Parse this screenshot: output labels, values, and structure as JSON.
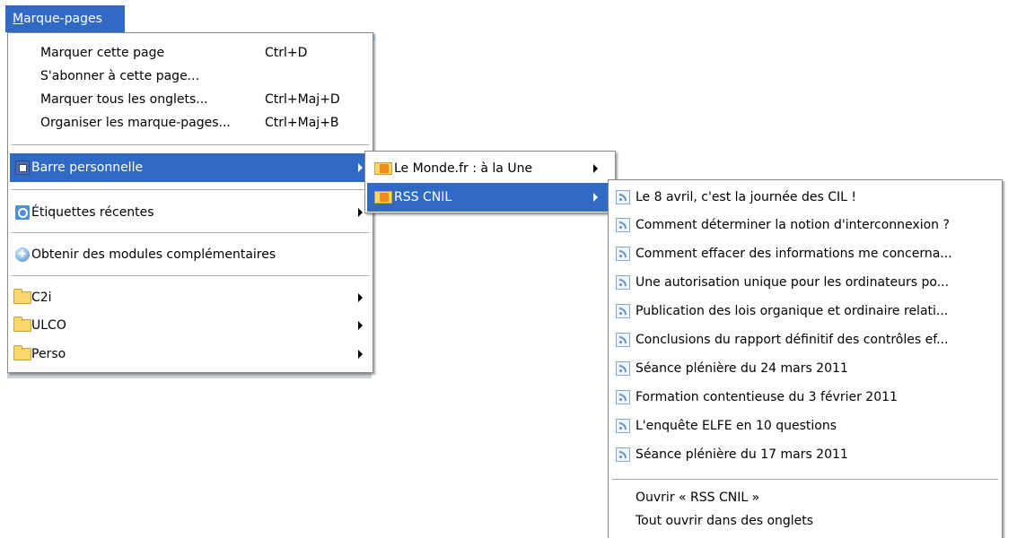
{
  "menubar": {
    "title": "Marque-pages",
    "title_accel": "M",
    "title_rest": "arque-pages"
  },
  "main_menu": {
    "items": [
      {
        "label": "Marquer cette page",
        "shortcut": "Ctrl+D"
      },
      {
        "label": "S'abonner à cette page...",
        "shortcut": ""
      },
      {
        "label": "Marquer tous les onglets...",
        "shortcut": "Ctrl+Maj+D"
      },
      {
        "label": "Organiser les marque-pages...",
        "shortcut": "Ctrl+Maj+B"
      },
      {
        "label": "Barre personnelle",
        "icon": "bookmarks-toolbar-icon"
      },
      {
        "label": "Étiquettes récentes",
        "icon": "tag-icon"
      },
      {
        "label": "Obtenir des modules complémentaires",
        "icon": "addons-icon"
      },
      {
        "label": "C2i",
        "icon": "folder-icon"
      },
      {
        "label": "ULCO",
        "icon": "folder-icon"
      },
      {
        "label": "Perso",
        "icon": "folder-icon"
      }
    ]
  },
  "toolbar_submenu": {
    "items": [
      {
        "label": "Le Monde.fr : à la Une",
        "icon": "rss-folder-icon"
      },
      {
        "label": "RSS CNIL",
        "icon": "rss-folder-icon"
      }
    ]
  },
  "rss_submenu": {
    "items": [
      {
        "label": "Le 8 avril, c'est la journée des CIL !"
      },
      {
        "label": "Comment déterminer la notion d'interconnexion ?"
      },
      {
        "label": "Comment effacer des informations me concerna..."
      },
      {
        "label": "Une autorisation unique pour les ordinateurs po..."
      },
      {
        "label": "Publication des lois organique et ordinaire relati..."
      },
      {
        "label": "Conclusions du rapport définitif des contrôles ef..."
      },
      {
        "label": "Séance plénière du 24 mars 2011"
      },
      {
        "label": "Formation contentieuse du 3 février 2011"
      },
      {
        "label": "L'enquête ELFE en 10 questions"
      },
      {
        "label": "Séance plénière du 17 mars 2011"
      }
    ],
    "open_label": "Ouvrir « RSS CNIL »",
    "open_all_label": "Tout ouvrir dans des onglets"
  },
  "colors": {
    "highlight": "#316ac5",
    "menu_bg": "#ffffff",
    "folder": "#fbd66a",
    "rss": "#f08a1c"
  }
}
